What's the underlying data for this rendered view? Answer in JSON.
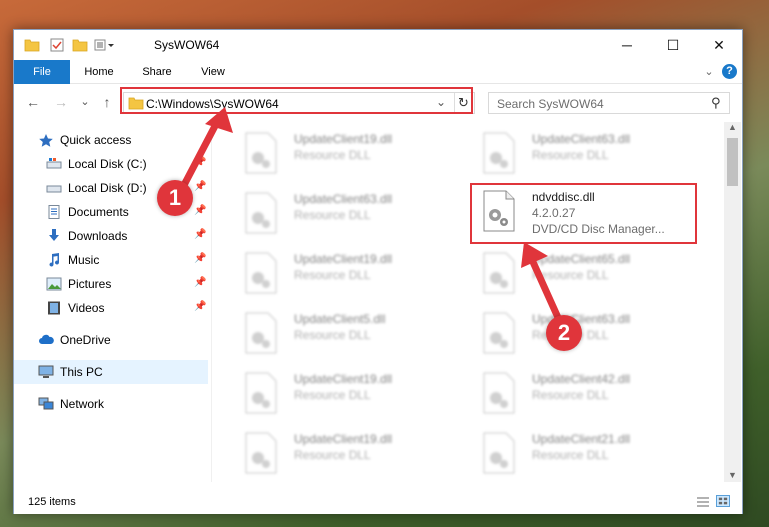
{
  "window": {
    "title": "SysWOW64",
    "minimize_symbol": "─",
    "maximize_symbol": "☐",
    "close_symbol": "✕"
  },
  "ribbon": {
    "tabs": [
      "File",
      "Home",
      "Share",
      "View"
    ],
    "expand_symbol": "⌄",
    "help_symbol": "?"
  },
  "address": {
    "path": "C:\\Windows\\SysWOW64",
    "dropdown_symbol": "⌄",
    "refresh_symbol": "↻"
  },
  "search": {
    "placeholder": "Search SysWOW64",
    "icon_symbol": "⚲"
  },
  "nav_buttons": {
    "back": "←",
    "forward": "→",
    "recent": "⌄",
    "up": "↑"
  },
  "nav": {
    "items": [
      {
        "label": "Quick access",
        "icon": "star-icon"
      },
      {
        "label": "Local Disk (C:)",
        "icon": "drive-icon",
        "pinned": true
      },
      {
        "label": "Local Disk (D:)",
        "icon": "drive-icon",
        "pinned": true
      },
      {
        "label": "Documents",
        "icon": "documents-icon",
        "pinned": true
      },
      {
        "label": "Downloads",
        "icon": "download-icon",
        "pinned": true
      },
      {
        "label": "Music",
        "icon": "music-icon",
        "pinned": true
      },
      {
        "label": "Pictures",
        "icon": "pictures-icon",
        "pinned": true
      },
      {
        "label": "Videos",
        "icon": "videos-icon",
        "pinned": true
      },
      {
        "label": "OneDrive",
        "icon": "cloud-icon"
      },
      {
        "label": "This PC",
        "icon": "computer-icon"
      },
      {
        "label": "Network",
        "icon": "network-icon"
      }
    ],
    "pin_symbol": "📌"
  },
  "files": {
    "left": [
      {
        "name": "UpdateClient19.dll",
        "desc": "Resource DLL"
      },
      {
        "name": "UpdateClient63.dll",
        "desc": "Resource DLL"
      },
      {
        "name": "UpdateClient19.dll",
        "desc": "Resource DLL"
      },
      {
        "name": "UpdateClient5.dll",
        "desc": "Resource DLL"
      },
      {
        "name": "UpdateClient19.dll",
        "desc": "Resource DLL"
      },
      {
        "name": "UpdateClient19.dll",
        "desc": "Resource DLL"
      }
    ],
    "right": [
      {
        "name": "UpdateClient63.dll",
        "desc": "Resource DLL"
      },
      {
        "name": "ndvddisc.dll",
        "version": "4.2.0.27",
        "desc": "DVD/CD Disc Manager..."
      },
      {
        "name": "UpdateClient65.dll",
        "desc": "Resource DLL"
      },
      {
        "name": "UpdateClient63.dll",
        "desc": "Resource DLL"
      },
      {
        "name": "UpdateClient42.dll",
        "desc": "Resource DLL"
      },
      {
        "name": "UpdateClient21.dll",
        "desc": "Resource DLL"
      }
    ]
  },
  "status": {
    "item_count": "125 items"
  },
  "annotations": {
    "step1": "1",
    "step2": "2",
    "color": "#e0353b"
  },
  "colors": {
    "ribbon_file_tab": "#1979ca",
    "selected_nav": "#cce8ff",
    "highlight": "#e0353b"
  }
}
